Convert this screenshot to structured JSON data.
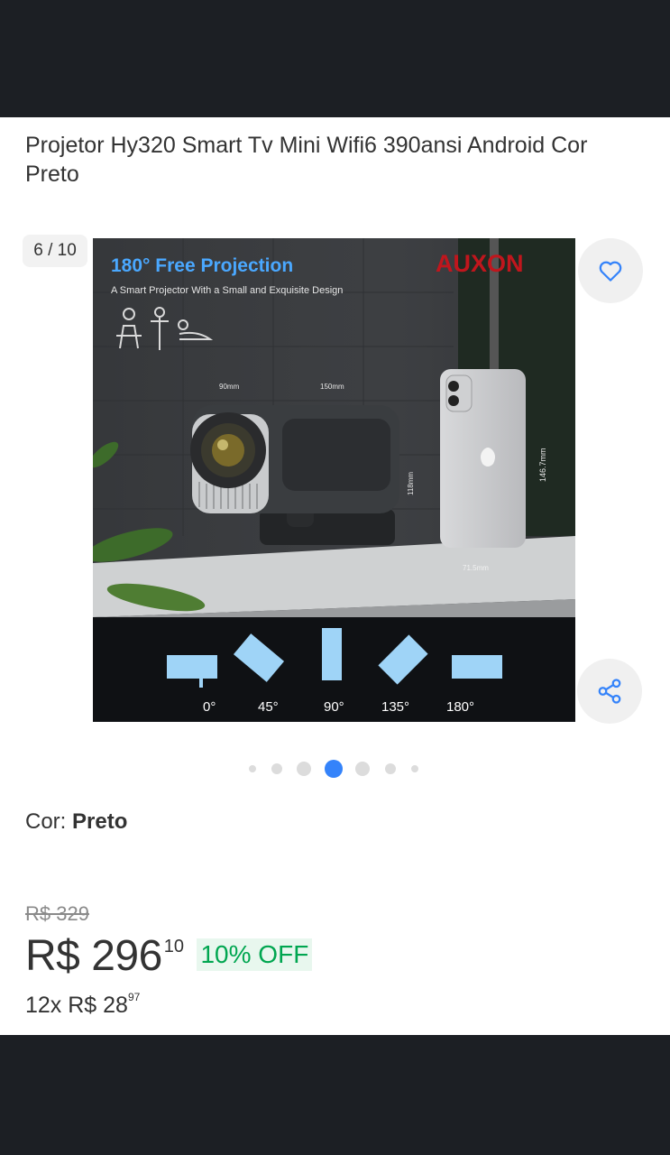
{
  "product": {
    "title": "Projetor Hy320 Smart Tv Mini Wifi6 390ansi Android Cor Preto"
  },
  "gallery": {
    "counter": "6 / 10",
    "image": {
      "headline": "180° Free Projection",
      "subheadline": "A Smart Projector With a Small and Exquisite Design",
      "brand": "AUXON",
      "dim_width": "90mm",
      "dim_depth": "150mm",
      "dim_height": "118mm",
      "phone_height": "146.7mm",
      "phone_width": "71.5mm",
      "angles": [
        "0°",
        "45°",
        "90°",
        "135°",
        "180°"
      ]
    },
    "dots_total": 7,
    "dots_active_index": 3
  },
  "variant": {
    "label": "Cor: ",
    "value": "Preto"
  },
  "pricing": {
    "old_price": "R$ 329",
    "price_main": "R$ 296",
    "price_cents": "10",
    "discount": "10% OFF",
    "installments_main": "12x R$ 28",
    "installments_cents": "97"
  },
  "icons": {
    "favorite": "heart-icon",
    "share": "share-icon"
  },
  "colors": {
    "discount_green": "#00a650",
    "accent_blue": "#3483fa",
    "dark_bar": "#1c1f24"
  }
}
